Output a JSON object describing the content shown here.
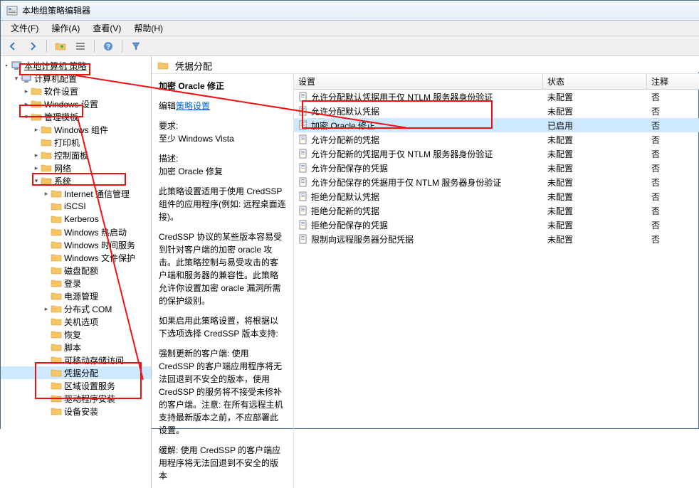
{
  "window": {
    "title": "本地组策略编辑器"
  },
  "menu": {
    "file": "文件(F)",
    "action": "操作(A)",
    "view": "查看(V)",
    "help": "帮助(H)"
  },
  "tree": {
    "root": "本地计算机 策略",
    "computer_cfg": "计算机配置",
    "software_settings": "软件设置",
    "windows_settings": "Windows 设置",
    "admin_templates": "管理模板",
    "windows_components": "Windows 组件",
    "printers": "打印机",
    "control_panel": "控制面板",
    "network": "网络",
    "system": "系统",
    "system_children": {
      "internet_comm": "Internet 通信管理",
      "iscsi": "iSCSI",
      "kerberos": "Kerberos",
      "win_hotstart": "Windows 热启动",
      "win_timesvc": "Windows 时间服务",
      "win_fileprot": "Windows 文件保护",
      "disk_quota": "磁盘配额",
      "logon": "登录",
      "power_mgmt": "电源管理",
      "dcom": "分布式 COM",
      "shutdown_opts": "关机选项",
      "recovery": "恢复",
      "scripts": "脚本",
      "removable_storage": "可移动存储访问",
      "cred_delegation": "凭据分配",
      "regional_settings": "区域设置服务",
      "driver_install": "驱动程序安装",
      "device_install": "设备安装"
    }
  },
  "right": {
    "title": "凭据分配",
    "selected_title": "加密 Oracle 修正",
    "edit_label": "编辑",
    "edit_link": "策略设置",
    "req_label": "要求:",
    "req_text": "至少 Windows Vista",
    "desc_label": "描述:",
    "desc_text": "加密 Oracle 修复",
    "p1": "此策略设置适用于使用 CredSSP 组件的应用程序(例如: 远程桌面连接)。",
    "p2": "CredSSP 协议的某些版本容易受到针对客户端的加密 oracle 攻击。此策略控制与易受攻击的客户端和服务器的兼容性。此策略允许你设置加密 oracle 漏洞所需的保护级别。",
    "p3": "如果启用此策略设置，将根据以下选项选择 CredSSP 版本支持:",
    "p4": "强制更新的客户端: 使用 CredSSP 的客户端应用程序将无法回退到不安全的版本，使用 CredSSP 的服务将不接受未修补的客户端。注意: 在所有远程主机支持最新版本之前，不应部署此设置。",
    "p5": "缓解: 使用 CredSSP 的客户端应用程序将无法回退到不安全的版本"
  },
  "columns": {
    "setting": "设置",
    "status": "状态",
    "comment": "注释"
  },
  "rows": [
    {
      "name": "允许分配默认凭据用于仅 NTLM 服务器身份验证",
      "status": "未配置",
      "comment": "否"
    },
    {
      "name": "允许分配默认凭据",
      "status": "未配置",
      "comment": "否"
    },
    {
      "name": "加密 Oracle 修正",
      "status": "已启用",
      "comment": "否",
      "selected": true
    },
    {
      "name": "允许分配新的凭据",
      "status": "未配置",
      "comment": "否"
    },
    {
      "name": "允许分配新的凭据用于仅 NTLM 服务器身份验证",
      "status": "未配置",
      "comment": "否"
    },
    {
      "name": "允许分配保存的凭据",
      "status": "未配置",
      "comment": "否"
    },
    {
      "name": "允许分配保存的凭据用于仅 NTLM 服务器身份验证",
      "status": "未配置",
      "comment": "否"
    },
    {
      "name": "拒绝分配默认凭据",
      "status": "未配置",
      "comment": "否"
    },
    {
      "name": "拒绝分配新的凭据",
      "status": "未配置",
      "comment": "否"
    },
    {
      "name": "拒绝分配保存的凭据",
      "status": "未配置",
      "comment": "否"
    },
    {
      "name": "限制向远程服务器分配凭据",
      "status": "未配置",
      "comment": "否"
    }
  ]
}
